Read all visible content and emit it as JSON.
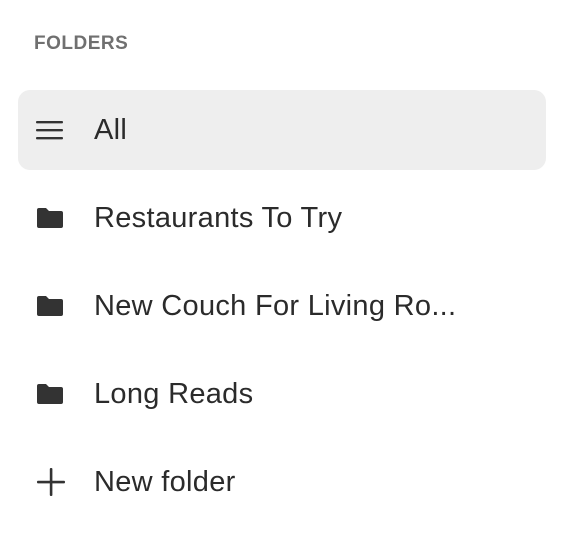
{
  "folders": {
    "section_title": "FOLDERS",
    "items": [
      {
        "label": "All",
        "icon": "menu-icon",
        "selected": true
      },
      {
        "label": "Restaurants To Try",
        "icon": "folder-icon",
        "selected": false
      },
      {
        "label": "New Couch For Living Ro...",
        "icon": "folder-icon",
        "selected": false
      },
      {
        "label": "Long Reads",
        "icon": "folder-icon",
        "selected": false
      }
    ],
    "new_folder_label": "New folder",
    "new_folder_icon": "plus-icon"
  },
  "colors": {
    "selected_background": "#eeeeee",
    "text": "#2b2b2b",
    "section_title": "#707070"
  }
}
